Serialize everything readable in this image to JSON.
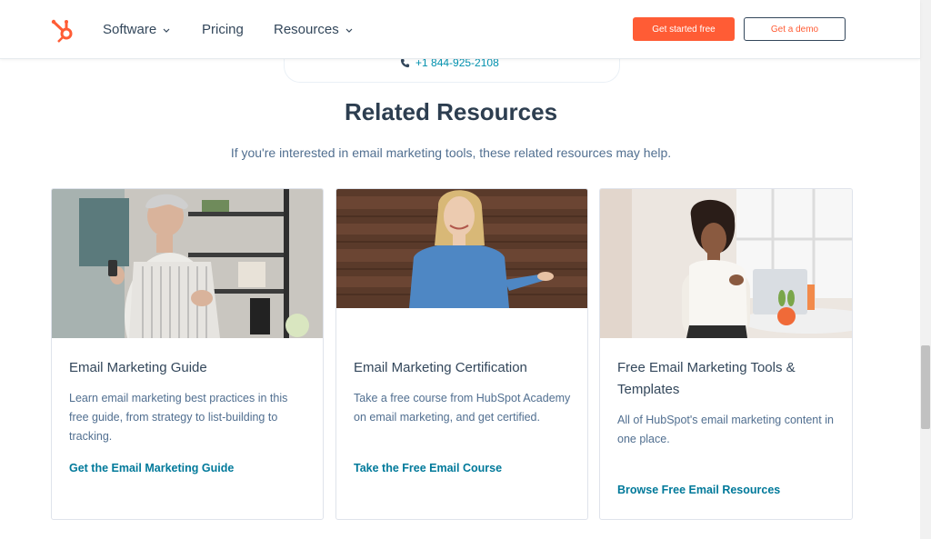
{
  "nav": {
    "items": [
      {
        "label": "Software",
        "has_dropdown": true
      },
      {
        "label": "Pricing",
        "has_dropdown": false
      },
      {
        "label": "Resources",
        "has_dropdown": true
      }
    ],
    "cta_primary": "Get started free",
    "cta_secondary": "Get a demo",
    "logo_icon": "hubspot-sprocket-icon"
  },
  "phone": {
    "number": "+1 844-925-2108",
    "icon": "phone-icon"
  },
  "section": {
    "title": "Related Resources",
    "subtitle": "If you're interested in email marketing tools, these related resources may help."
  },
  "cards": [
    {
      "title": "Email Marketing Guide",
      "description": "Learn email marketing best practices in this free guide, from strategy to list-building to tracking.",
      "link": "Get the Email Marketing Guide",
      "image": "woman-with-phone-photo"
    },
    {
      "title": "Email Marketing Certification",
      "description": "Take a free course from HubSpot Academy on email marketing, and get certified.",
      "link": "Take the Free Email Course",
      "image": "instructor-photo"
    },
    {
      "title": "Free Email Marketing Tools & Templates",
      "description": "All of HubSpot's email marketing content in one place.",
      "link": "Browse Free Email Resources",
      "image": "woman-with-laptop-photo"
    }
  ],
  "colors": {
    "brand_orange": "#ff5c35",
    "heading": "#2d3e50",
    "text": "#33475b",
    "link": "#00799a"
  }
}
